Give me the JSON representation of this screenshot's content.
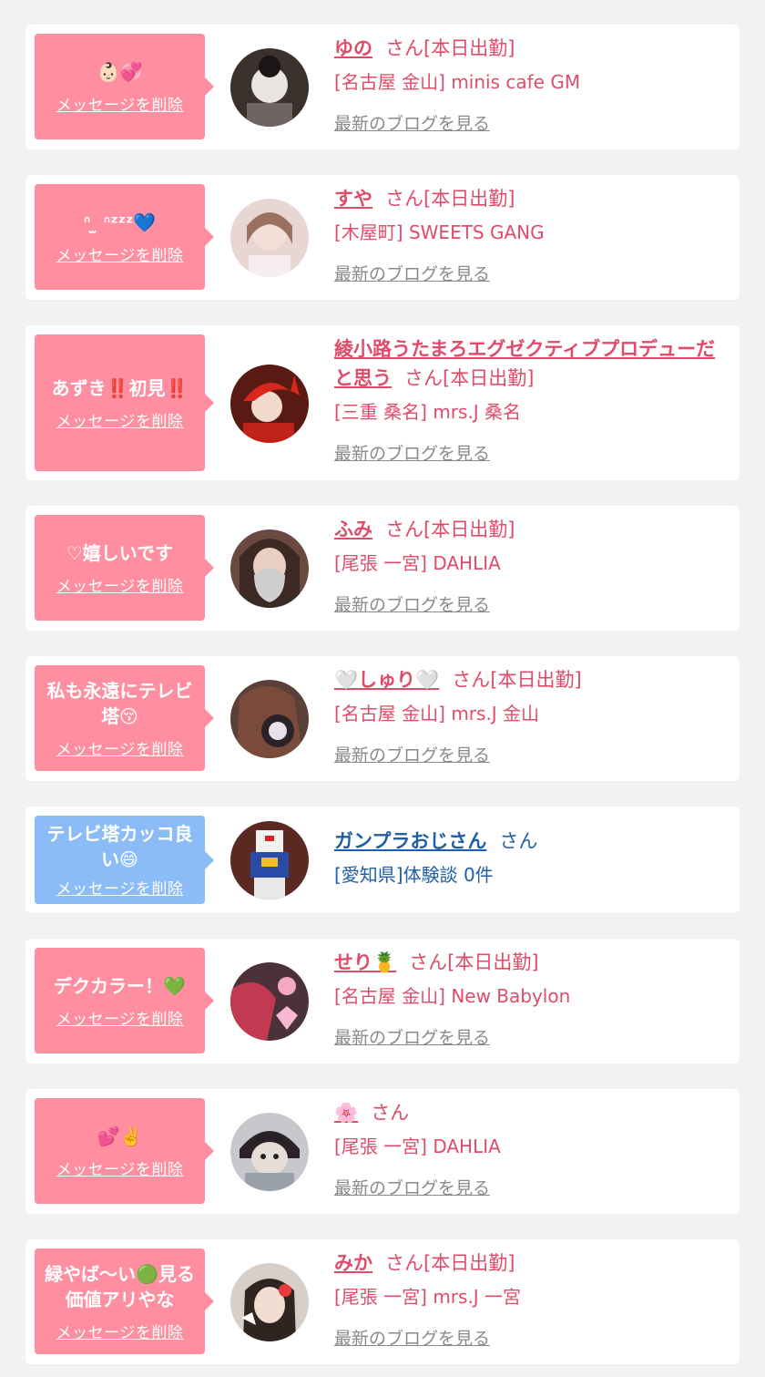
{
  "delete_label": "メッセージを削除",
  "blog_label": "最新のブログを見る",
  "colors": {
    "pink": "#ff8ea0",
    "blue": "#8bbcf8",
    "name_pink": "#e04b6a",
    "name_blue": "#1f5fa6"
  },
  "items": [
    {
      "message": "👶🏻💞",
      "name": "ゆの",
      "suffix": "さん[本日出勤]",
      "shop": "[名古屋 金山] minis cafe GM",
      "blog": "最新のブログを見る",
      "avatar_icon": "girl-photo-avatar",
      "theme": "pink"
    },
    {
      "message": "ᐢ ̫ ᐢᶻᶻᶻ💙",
      "name": "すや",
      "suffix": "さん[本日出勤]",
      "shop": "[木屋町] SWEETS GANG",
      "blog": "最新のブログを見る",
      "avatar_icon": "girl-photo-avatar",
      "theme": "pink"
    },
    {
      "message": "あずき‼️初見‼️",
      "name": "綾小路うたまろエグゼクティブプロデューだと思う",
      "suffix": "さん[本日出勤]",
      "shop": "[三重 桑名] mrs.J 桑名",
      "blog": "最新のブログを見る",
      "avatar_icon": "girl-photo-avatar",
      "theme": "pink"
    },
    {
      "message": "♡嬉しいです",
      "name": "ふみ",
      "suffix": "さん[本日出勤]",
      "shop": "[尾張 一宮] DAHLIA",
      "blog": "最新のブログを見る",
      "avatar_icon": "girl-photo-avatar",
      "theme": "pink"
    },
    {
      "message": "私も永遠にテレビ塔😚",
      "name": "🤍しゅり🤍",
      "suffix": "さん[本日出勤]",
      "shop": "[名古屋 金山] mrs.J 金山",
      "blog": "最新のブログを見る",
      "avatar_icon": "girl-photo-avatar",
      "theme": "pink"
    },
    {
      "message": "テレビ塔カッコ良い😄",
      "name": "ガンプラおじさん",
      "suffix": "さん",
      "shop": "[愛知県]体験談 0件",
      "blog": "",
      "avatar_icon": "robot-model-avatar",
      "theme": "blue"
    },
    {
      "message": "デクカラー！💚",
      "name": "せり🍍",
      "suffix": "さん[本日出勤]",
      "shop": "[名古屋 金山] New Babylon",
      "blog": "最新のブログを見る",
      "avatar_icon": "girl-photo-avatar",
      "theme": "pink"
    },
    {
      "message": "💕✌️",
      "name": "🌸",
      "suffix": "さん",
      "shop": "[尾張 一宮] DAHLIA",
      "blog": "最新のブログを見る",
      "avatar_icon": "hamster-photo-avatar",
      "theme": "pink"
    },
    {
      "message": "緑やば〜い🟢見る価値アリやな",
      "name": "みか",
      "suffix": "さん[本日出勤]",
      "shop": "[尾張 一宮] mrs.J 一宮",
      "blog": "最新のブログを見る",
      "avatar_icon": "girl-photo-avatar",
      "theme": "pink"
    }
  ]
}
